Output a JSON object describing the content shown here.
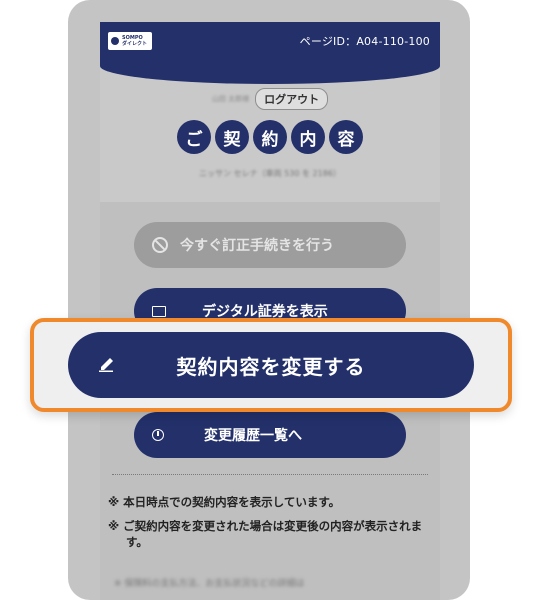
{
  "header": {
    "logo_text": "SOMPO\nダイレクト",
    "page_id": "ページID：A04-110-100"
  },
  "user": {
    "name": "山田 太郎様",
    "logout_label": "ログアウト"
  },
  "title_chars": [
    "ご",
    "契",
    "約",
    "内",
    "容"
  ],
  "vehicle": "ニッサン セレナ（車両 530 を 2186）",
  "buttons": {
    "correct": "今すぐ訂正手続きを行う",
    "digital_cert": "デジタル証券を表示",
    "change_contract": "契約内容を変更する",
    "history": "変更履歴一覧へ"
  },
  "notes": [
    "※ 本日時点での契約内容を表示しています。",
    "※ ご契約内容を変更された場合は変更後の内容が表示されます。"
  ],
  "note_blurred": "※ 保険料の支払方法、お支払状況などの詳細は",
  "colors": {
    "brand_navy": "#23306a",
    "highlight_orange": "#f0892b",
    "disabled_gray": "#9d9d9d"
  },
  "icons": {
    "correct": "prohibit-icon",
    "digital_cert": "document-icon",
    "change_contract": "edit-pen-icon",
    "history": "clock-icon"
  }
}
